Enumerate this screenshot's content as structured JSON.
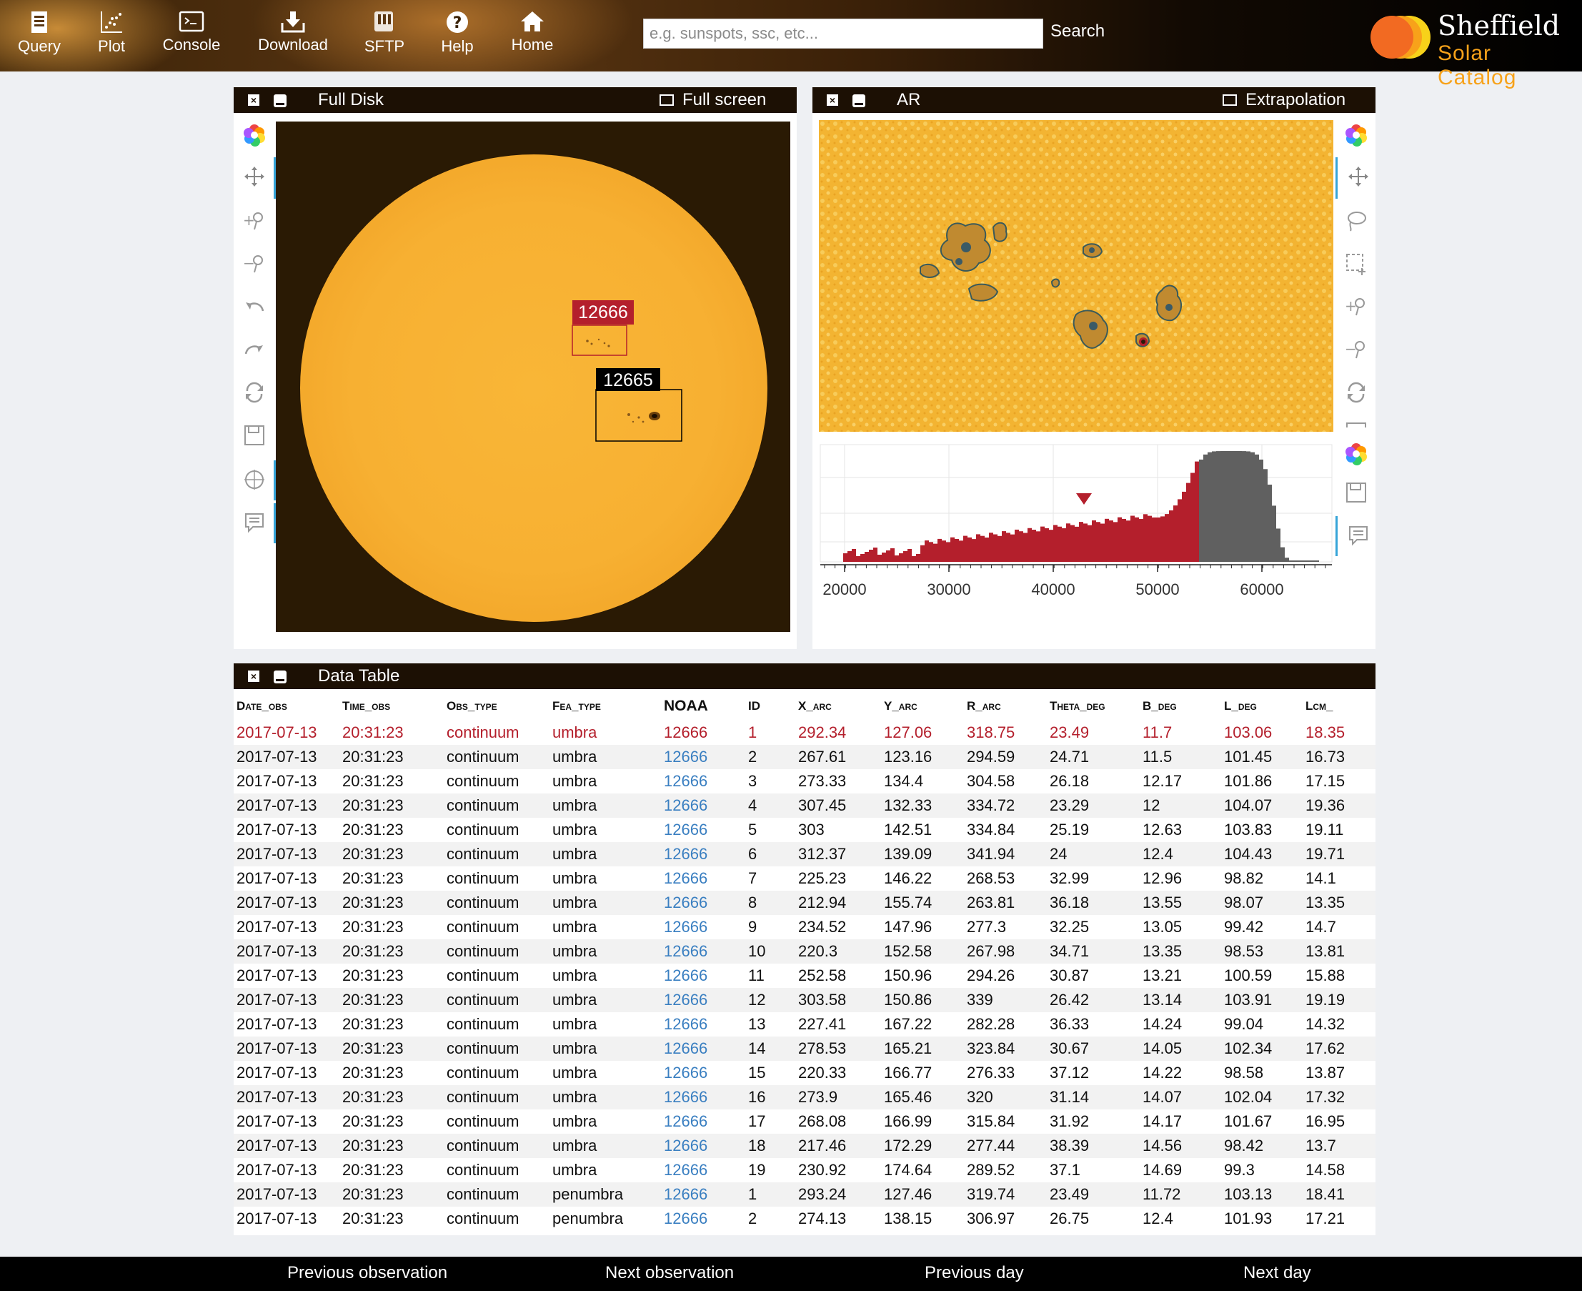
{
  "nav": {
    "items": [
      {
        "label": "Query",
        "icon": "query-icon"
      },
      {
        "label": "Plot",
        "icon": "plot-icon"
      },
      {
        "label": "Console",
        "icon": "console-icon"
      },
      {
        "label": "Download",
        "icon": "download-icon"
      },
      {
        "label": "SFTP",
        "icon": "sftp-icon"
      },
      {
        "label": "Help",
        "icon": "help-icon"
      },
      {
        "label": "Home",
        "icon": "home-icon"
      }
    ],
    "search_placeholder": "e.g. sunspots, ssc, etc...",
    "search_label": "Search",
    "logo_line1": "Sheffield",
    "logo_line2": "Solar Catalog"
  },
  "full_disk": {
    "title": "Full Disk",
    "action": "Full screen",
    "regions": [
      {
        "label": "12666",
        "color": "#b41f2c"
      },
      {
        "label": "12665",
        "color": "#000000"
      }
    ]
  },
  "ar": {
    "title": "AR",
    "action": "Extrapolation",
    "histogram": {
      "x_ticks": [
        "20000",
        "30000",
        "40000",
        "50000",
        "60000"
      ],
      "selected_color": "#b41f2c",
      "unselected_color": "#606060"
    }
  },
  "table": {
    "title": "Data Table",
    "columns": [
      "Date_obs",
      "Time_obs",
      "Obs_type",
      "Fea_type",
      "NOAA",
      "ID",
      "X_arc",
      "Y_arc",
      "R_arc",
      "Theta_deg",
      "B_deg",
      "L_deg",
      "Lcm_"
    ],
    "rows": [
      [
        "2017-07-13",
        "20:31:23",
        "continuum",
        "umbra",
        "12666",
        "1",
        "292.34",
        "127.06",
        "318.75",
        "23.49",
        "11.7",
        "103.06",
        "18.35"
      ],
      [
        "2017-07-13",
        "20:31:23",
        "continuum",
        "umbra",
        "12666",
        "2",
        "267.61",
        "123.16",
        "294.59",
        "24.71",
        "11.5",
        "101.45",
        "16.73"
      ],
      [
        "2017-07-13",
        "20:31:23",
        "continuum",
        "umbra",
        "12666",
        "3",
        "273.33",
        "134.4",
        "304.58",
        "26.18",
        "12.17",
        "101.86",
        "17.15"
      ],
      [
        "2017-07-13",
        "20:31:23",
        "continuum",
        "umbra",
        "12666",
        "4",
        "307.45",
        "132.33",
        "334.72",
        "23.29",
        "12",
        "104.07",
        "19.36"
      ],
      [
        "2017-07-13",
        "20:31:23",
        "continuum",
        "umbra",
        "12666",
        "5",
        "303",
        "142.51",
        "334.84",
        "25.19",
        "12.63",
        "103.83",
        "19.11"
      ],
      [
        "2017-07-13",
        "20:31:23",
        "continuum",
        "umbra",
        "12666",
        "6",
        "312.37",
        "139.09",
        "341.94",
        "24",
        "12.4",
        "104.43",
        "19.71"
      ],
      [
        "2017-07-13",
        "20:31:23",
        "continuum",
        "umbra",
        "12666",
        "7",
        "225.23",
        "146.22",
        "268.53",
        "32.99",
        "12.96",
        "98.82",
        "14.1"
      ],
      [
        "2017-07-13",
        "20:31:23",
        "continuum",
        "umbra",
        "12666",
        "8",
        "212.94",
        "155.74",
        "263.81",
        "36.18",
        "13.55",
        "98.07",
        "13.35"
      ],
      [
        "2017-07-13",
        "20:31:23",
        "continuum",
        "umbra",
        "12666",
        "9",
        "234.52",
        "147.96",
        "277.3",
        "32.25",
        "13.05",
        "99.42",
        "14.7"
      ],
      [
        "2017-07-13",
        "20:31:23",
        "continuum",
        "umbra",
        "12666",
        "10",
        "220.3",
        "152.58",
        "267.98",
        "34.71",
        "13.35",
        "98.53",
        "13.81"
      ],
      [
        "2017-07-13",
        "20:31:23",
        "continuum",
        "umbra",
        "12666",
        "11",
        "252.58",
        "150.96",
        "294.26",
        "30.87",
        "13.21",
        "100.59",
        "15.88"
      ],
      [
        "2017-07-13",
        "20:31:23",
        "continuum",
        "umbra",
        "12666",
        "12",
        "303.58",
        "150.86",
        "339",
        "26.42",
        "13.14",
        "103.91",
        "19.19"
      ],
      [
        "2017-07-13",
        "20:31:23",
        "continuum",
        "umbra",
        "12666",
        "13",
        "227.41",
        "167.22",
        "282.28",
        "36.33",
        "14.24",
        "99.04",
        "14.32"
      ],
      [
        "2017-07-13",
        "20:31:23",
        "continuum",
        "umbra",
        "12666",
        "14",
        "278.53",
        "165.21",
        "323.84",
        "30.67",
        "14.05",
        "102.34",
        "17.62"
      ],
      [
        "2017-07-13",
        "20:31:23",
        "continuum",
        "umbra",
        "12666",
        "15",
        "220.33",
        "166.77",
        "276.33",
        "37.12",
        "14.22",
        "98.58",
        "13.87"
      ],
      [
        "2017-07-13",
        "20:31:23",
        "continuum",
        "umbra",
        "12666",
        "16",
        "273.9",
        "165.46",
        "320",
        "31.14",
        "14.07",
        "102.04",
        "17.32"
      ],
      [
        "2017-07-13",
        "20:31:23",
        "continuum",
        "umbra",
        "12666",
        "17",
        "268.08",
        "166.99",
        "315.84",
        "31.92",
        "14.17",
        "101.67",
        "16.95"
      ],
      [
        "2017-07-13",
        "20:31:23",
        "continuum",
        "umbra",
        "12666",
        "18",
        "217.46",
        "172.29",
        "277.44",
        "38.39",
        "14.56",
        "98.42",
        "13.7"
      ],
      [
        "2017-07-13",
        "20:31:23",
        "continuum",
        "umbra",
        "12666",
        "19",
        "230.92",
        "174.64",
        "289.52",
        "37.1",
        "14.69",
        "99.3",
        "14.58"
      ],
      [
        "2017-07-13",
        "20:31:23",
        "continuum",
        "penumbra",
        "12666",
        "1",
        "293.24",
        "127.46",
        "319.74",
        "23.49",
        "11.72",
        "103.13",
        "18.41"
      ],
      [
        "2017-07-13",
        "20:31:23",
        "continuum",
        "penumbra",
        "12666",
        "2",
        "274.13",
        "138.15",
        "306.97",
        "26.75",
        "12.4",
        "101.93",
        "17.21"
      ]
    ]
  },
  "footer": {
    "prev_obs": "Previous observation",
    "next_obs": "Next observation",
    "prev_day": "Previous day",
    "next_day": "Next day"
  }
}
